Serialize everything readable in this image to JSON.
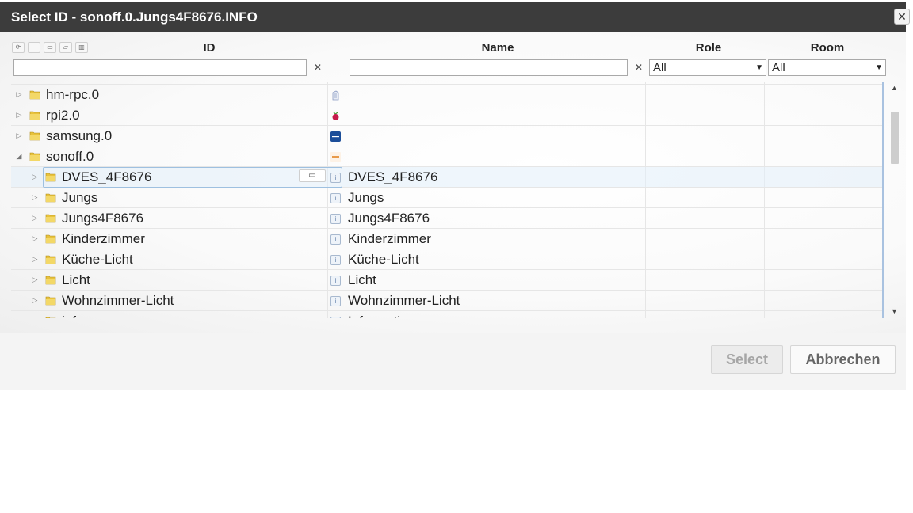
{
  "dialog": {
    "title": "Select ID - sonoff.0.Jungs4F8676.INFO",
    "close_glyph": "✕"
  },
  "toolbar": {
    "icons": [
      "refresh-icon",
      "collapse-icon",
      "folder-closed-icon",
      "folder-open-icon",
      "columns-icon"
    ]
  },
  "columns": {
    "id": "ID",
    "name": "Name",
    "role": "Role",
    "room": "Room"
  },
  "filters": {
    "id_value": "",
    "name_value": "",
    "clear_glyph": "✕",
    "role_selected": "All",
    "room_selected": "All"
  },
  "tree": {
    "partial_top": "",
    "rows": [
      {
        "id": "hm-rpc.0",
        "name": "",
        "icon": "homematic-icon",
        "level": 0,
        "expanded": false
      },
      {
        "id": "rpi2.0",
        "name": "",
        "icon": "raspberry-pi-icon",
        "level": 0,
        "expanded": false
      },
      {
        "id": "samsung.0",
        "name": "",
        "icon": "samsung-icon",
        "level": 0,
        "expanded": false
      },
      {
        "id": "sonoff.0",
        "name": "",
        "icon": "sonoff-icon",
        "level": 0,
        "expanded": true
      },
      {
        "id": "DVES_4F8676",
        "name": "DVES_4F8676",
        "icon": "device-icon",
        "level": 1,
        "expanded": false,
        "selected": true
      },
      {
        "id": "Jungs",
        "name": "Jungs",
        "icon": "device-icon",
        "level": 1,
        "expanded": false
      },
      {
        "id": "Jungs4F8676",
        "name": "Jungs4F8676",
        "icon": "device-icon",
        "level": 1,
        "expanded": false
      },
      {
        "id": "Kinderzimmer",
        "name": "Kinderzimmer",
        "icon": "device-icon",
        "level": 1,
        "expanded": false
      },
      {
        "id": "Küche-Licht",
        "name": "Küche-Licht",
        "icon": "device-icon",
        "level": 1,
        "expanded": false
      },
      {
        "id": "Licht",
        "name": "Licht",
        "icon": "device-icon",
        "level": 1,
        "expanded": false
      },
      {
        "id": "Wohnzimmer-Licht",
        "name": "Wohnzimmer-Licht",
        "icon": "device-icon",
        "level": 1,
        "expanded": false
      },
      {
        "id": "info",
        "name": "Information",
        "icon": "device-icon",
        "level": 1,
        "expanded": false
      }
    ]
  },
  "buttons": {
    "select": "Select",
    "cancel": "Abbrechen"
  },
  "colors": {
    "titlebar": "#3c3c3c",
    "folder": "#e8c23c",
    "selection": "#e2eefa"
  }
}
